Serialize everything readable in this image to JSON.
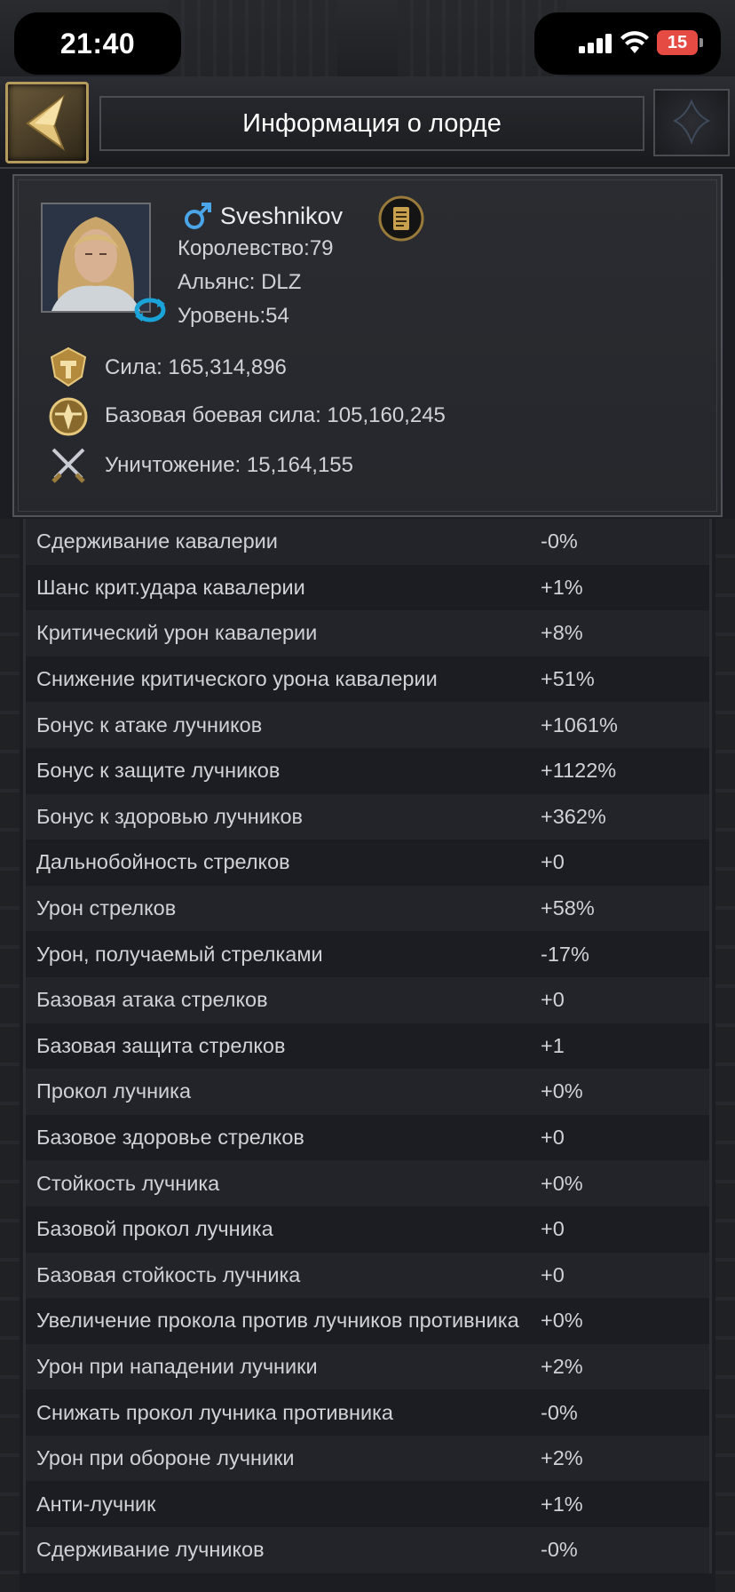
{
  "status_bar": {
    "time": "21:40",
    "battery": "15"
  },
  "header": {
    "title": "Информация о лорде"
  },
  "profile": {
    "name": "Sveshnikov",
    "kingdom": "Королевство:79",
    "alliance": "Альянс: DLZ",
    "level": "Уровень:54",
    "power": "Сила: 165,314,896",
    "base_combat_power": "Базовая боевая сила: 105,160,245",
    "kills": "Уничтожение: 15,164,155"
  },
  "stats": [
    {
      "name": "Сдерживание кавалерии",
      "value": "-0%"
    },
    {
      "name": "Шанс крит.удара кавалерии",
      "value": "+1%"
    },
    {
      "name": "Критический урон кавалерии",
      "value": "+8%"
    },
    {
      "name": "Снижение критического урона кавалерии",
      "value": "+51%"
    },
    {
      "name": "Бонус к атаке лучников",
      "value": "+1061%"
    },
    {
      "name": "Бонус к защите лучников",
      "value": "+1122%"
    },
    {
      "name": "Бонус к здоровью лучников",
      "value": "+362%"
    },
    {
      "name": "Дальнобойность стрелков",
      "value": "+0"
    },
    {
      "name": "Урон стрелков",
      "value": "+58%"
    },
    {
      "name": "Урон, получаемый стрелками",
      "value": "-17%"
    },
    {
      "name": "Базовая атака стрелков",
      "value": "+0"
    },
    {
      "name": "Базовая защита стрелков",
      "value": "+1"
    },
    {
      "name": "Прокол лучника",
      "value": "+0%"
    },
    {
      "name": "Базовое здоровье стрелков",
      "value": "+0"
    },
    {
      "name": "Стойкость лучника",
      "value": "+0%"
    },
    {
      "name": "Базовой прокол лучника",
      "value": "+0"
    },
    {
      "name": "Базовая стойкость лучника",
      "value": "+0"
    },
    {
      "name": "Увеличение прокола против лучников противника",
      "value": "+0%"
    },
    {
      "name": "Урон при нападении лучники",
      "value": "+2%"
    },
    {
      "name": "Снижать прокол лучника противника",
      "value": "-0%"
    },
    {
      "name": "Урон при обороне лучники",
      "value": "+2%"
    },
    {
      "name": "Анти-лучник",
      "value": "+1%"
    },
    {
      "name": "Сдерживание лучников",
      "value": "-0%"
    }
  ]
}
